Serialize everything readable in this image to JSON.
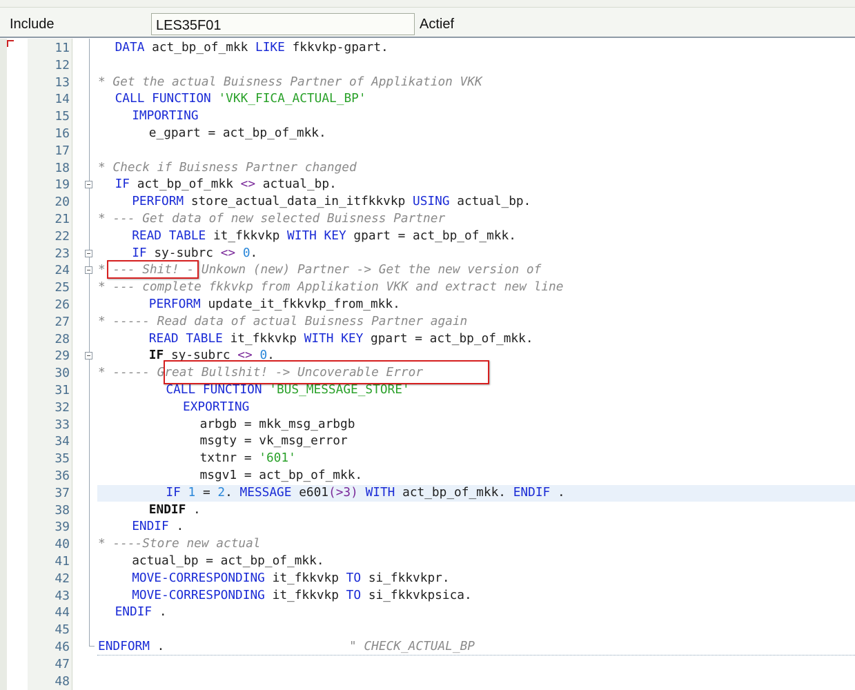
{
  "header": {
    "include_label": "Include",
    "include_value": "LES35F01",
    "status": "Actief"
  },
  "editor": {
    "lines": [
      {
        "no": "11",
        "indent": 1,
        "tokens": [
          [
            "kw",
            "DATA"
          ],
          [
            "",
            "act_bp_of_mkk "
          ],
          [
            "kw",
            "LIKE"
          ],
          [
            "",
            "fkkvkp-gpart."
          ]
        ]
      },
      {
        "no": "12",
        "indent": 0,
        "tokens": []
      },
      {
        "no": "13",
        "indent": 0,
        "tokens": [
          [
            "cmt",
            "* Get the actual Buisness Partner of Applikation VKK"
          ]
        ]
      },
      {
        "no": "14",
        "indent": 1,
        "tokens": [
          [
            "kw",
            "CALL FUNCTION "
          ],
          [
            "str",
            "'VKK_FICA_ACTUAL_BP'"
          ]
        ]
      },
      {
        "no": "15",
        "indent": 2,
        "tokens": [
          [
            "kw",
            "IMPORTING"
          ]
        ]
      },
      {
        "no": "16",
        "indent": 3,
        "tokens": [
          [
            "",
            "e_gpart = act_bp_of_mkk."
          ]
        ]
      },
      {
        "no": "17",
        "indent": 0,
        "tokens": []
      },
      {
        "no": "18",
        "indent": 0,
        "tokens": [
          [
            "cmt",
            "* Check if Buisness Partner changed"
          ]
        ]
      },
      {
        "no": "19",
        "indent": 1,
        "fold": true,
        "tokens": [
          [
            "kw",
            "IF"
          ],
          [
            "",
            "act_bp_of_mkk "
          ],
          [
            "op",
            "<>"
          ],
          [
            "",
            " actual_bp."
          ]
        ]
      },
      {
        "no": "20",
        "indent": 2,
        "tokens": [
          [
            "kw",
            "PERFORM"
          ],
          [
            "",
            "store_actual_data_in_itfkkvkp "
          ],
          [
            "kw",
            "USING"
          ],
          [
            "",
            "actual_bp."
          ]
        ]
      },
      {
        "no": "21",
        "indent": 0,
        "tokens": [
          [
            "cmt",
            "* --- Get data of new selected Buisness Partner"
          ]
        ]
      },
      {
        "no": "22",
        "indent": 2,
        "tokens": [
          [
            "kw",
            "READ TABLE"
          ],
          [
            "",
            "it_fkkvkp "
          ],
          [
            "kw",
            "WITH KEY"
          ],
          [
            "",
            "gpart = act_bp_of_mkk."
          ]
        ]
      },
      {
        "no": "23",
        "indent": 2,
        "fold": true,
        "tokens": [
          [
            "kw",
            "IF"
          ],
          [
            "",
            "sy-subrc "
          ],
          [
            "op",
            "<>"
          ],
          [
            "",
            " "
          ],
          [
            "num",
            "0"
          ],
          [
            "",
            "."
          ]
        ]
      },
      {
        "no": "24",
        "indent": 0,
        "fold": true,
        "tokens": [
          [
            "cmt",
            "* --- Shit! - Unkown (new) Partner -> Get the new version of"
          ]
        ]
      },
      {
        "no": "25",
        "indent": 0,
        "tokens": [
          [
            "cmt",
            "* --- complete fkkvkp from Applikation VKK and extract new line"
          ]
        ]
      },
      {
        "no": "26",
        "indent": 3,
        "tokens": [
          [
            "kw",
            "PERFORM"
          ],
          [
            "",
            "update_it_fkkvkp_from_mkk."
          ]
        ]
      },
      {
        "no": "27",
        "indent": 0,
        "tokens": [
          [
            "cmt",
            "* ----- Read data of actual Buisness Partner again"
          ]
        ]
      },
      {
        "no": "28",
        "indent": 3,
        "tokens": [
          [
            "kw",
            "READ TABLE"
          ],
          [
            "",
            "it_fkkvkp "
          ],
          [
            "kw",
            "WITH KEY"
          ],
          [
            "",
            "gpart = act_bp_of_mkk."
          ]
        ]
      },
      {
        "no": "29",
        "indent": 3,
        "fold": true,
        "tokens": [
          [
            "kwb",
            "IF"
          ],
          [
            "",
            "sy-subrc "
          ],
          [
            "op",
            "<>"
          ],
          [
            "",
            " "
          ],
          [
            "num",
            "0"
          ],
          [
            "",
            "."
          ]
        ]
      },
      {
        "no": "30",
        "indent": 0,
        "tokens": [
          [
            "cmt",
            "* ----- Great Bullshit! -> Uncoverable Error"
          ]
        ]
      },
      {
        "no": "31",
        "indent": 4,
        "tokens": [
          [
            "kw",
            "CALL FUNCTION "
          ],
          [
            "str",
            "'BUS_MESSAGE_STORE'"
          ]
        ]
      },
      {
        "no": "32",
        "indent": 5,
        "tokens": [
          [
            "kw",
            "EXPORTING"
          ]
        ]
      },
      {
        "no": "33",
        "indent": 6,
        "tokens": [
          [
            "",
            "arbgb = mkk_msg_arbgb"
          ]
        ]
      },
      {
        "no": "34",
        "indent": 6,
        "tokens": [
          [
            "",
            "msgty = vk_msg_error"
          ]
        ]
      },
      {
        "no": "35",
        "indent": 6,
        "tokens": [
          [
            "",
            "txtnr = "
          ],
          [
            "str",
            "'601'"
          ]
        ]
      },
      {
        "no": "36",
        "indent": 6,
        "tokens": [
          [
            "",
            "msgv1 = act_bp_of_mkk."
          ]
        ]
      },
      {
        "no": "37",
        "indent": 4,
        "highlight": true,
        "tokens": [
          [
            "kw",
            "IF"
          ],
          [
            "num",
            "1"
          ],
          [
            "",
            " = "
          ],
          [
            "num",
            "2"
          ],
          [
            "",
            "."
          ],
          [
            "",
            " "
          ],
          [
            "kw",
            "MESSAGE"
          ],
          [
            "",
            "e601"
          ],
          [
            "op",
            "(>3)"
          ],
          [
            "",
            " "
          ],
          [
            "kw",
            "WITH"
          ],
          [
            "",
            "act_bp_of_mkk. "
          ],
          [
            "kw",
            "ENDIF"
          ],
          [
            "",
            "."
          ]
        ]
      },
      {
        "no": "38",
        "indent": 3,
        "tokens": [
          [
            "kwb",
            "ENDIF"
          ],
          [
            "",
            "."
          ]
        ]
      },
      {
        "no": "39",
        "indent": 2,
        "tokens": [
          [
            "kw",
            "ENDIF"
          ],
          [
            "",
            "."
          ]
        ]
      },
      {
        "no": "40",
        "indent": 0,
        "tokens": [
          [
            "cmt",
            "* ----Store new actual"
          ]
        ]
      },
      {
        "no": "41",
        "indent": 2,
        "tokens": [
          [
            "",
            "actual_bp = act_bp_of_mkk."
          ]
        ]
      },
      {
        "no": "42",
        "indent": 2,
        "tokens": [
          [
            "kw",
            "MOVE-CORRESPONDING"
          ],
          [
            "",
            "it_fkkvkp "
          ],
          [
            "kw",
            "TO"
          ],
          [
            "",
            "si_fkkvkpr."
          ]
        ]
      },
      {
        "no": "43",
        "indent": 2,
        "tokens": [
          [
            "kw",
            "MOVE-CORRESPONDING"
          ],
          [
            "",
            "it_fkkvkp "
          ],
          [
            "kw",
            "TO"
          ],
          [
            "",
            "si_fkkvkpsica."
          ]
        ]
      },
      {
        "no": "44",
        "indent": 1,
        "tokens": [
          [
            "kw",
            "ENDIF"
          ],
          [
            "",
            "."
          ]
        ]
      },
      {
        "no": "45",
        "indent": 0,
        "tokens": []
      },
      {
        "no": "46",
        "indent": 0,
        "dotted": true,
        "tokens": [
          [
            "kw",
            "ENDFORM"
          ],
          [
            "",
            ".                         "
          ],
          [
            "cmt",
            "\" CHECK_ACTUAL_BP"
          ]
        ]
      },
      {
        "no": "47",
        "indent": 0,
        "tokens": []
      },
      {
        "no": "48",
        "indent": 0,
        "tokens": []
      }
    ]
  },
  "annotations": {
    "box1_color": "#d61f1f",
    "box2_color": "#d61f1f"
  }
}
